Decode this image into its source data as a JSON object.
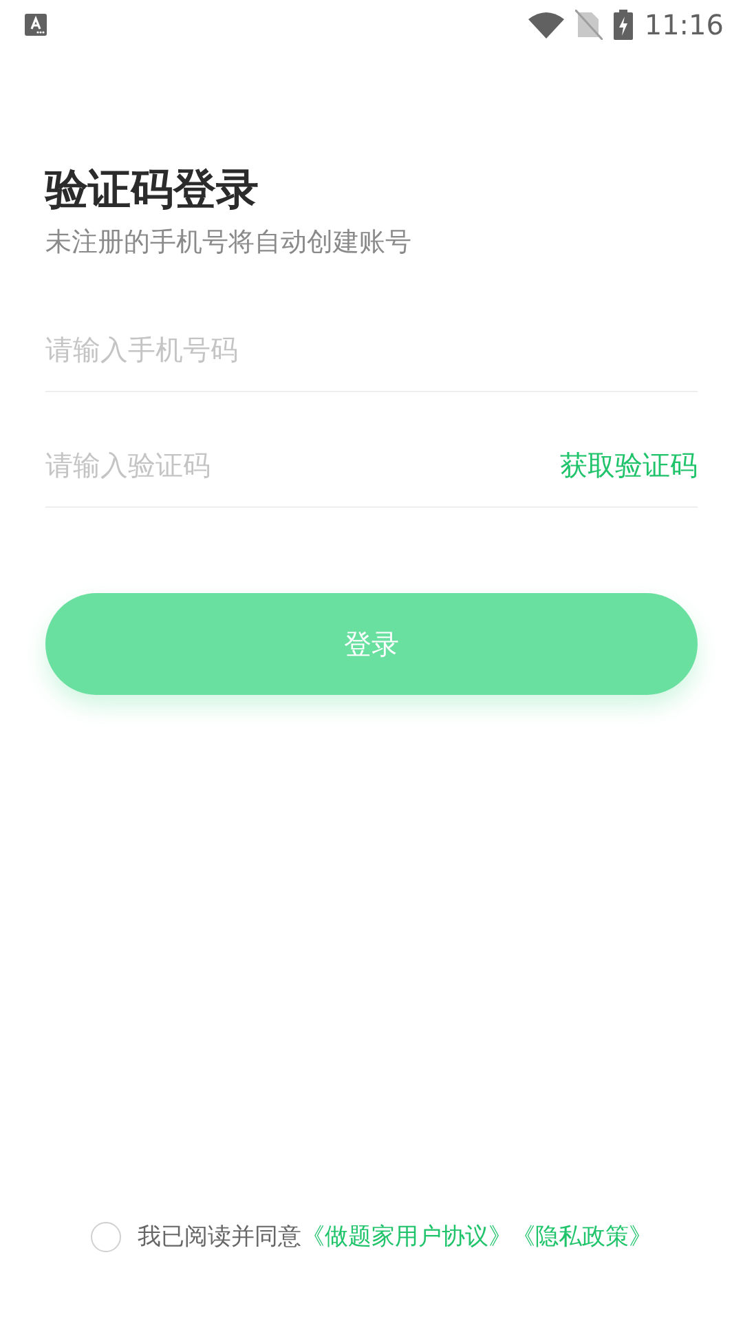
{
  "status_bar": {
    "time": "11:16"
  },
  "title": "验证码登录",
  "subtitle": "未注册的手机号将自动创建账号",
  "phone_field": {
    "placeholder": "请输入手机号码"
  },
  "code_field": {
    "placeholder": "请输入验证码",
    "action": "获取验证码"
  },
  "login_button": {
    "label": "登录",
    "disabled": true
  },
  "agreement": {
    "checked": false,
    "text": "我已阅读并同意",
    "links": [
      "《做题家用户协议》",
      "《隐私政策》"
    ]
  }
}
